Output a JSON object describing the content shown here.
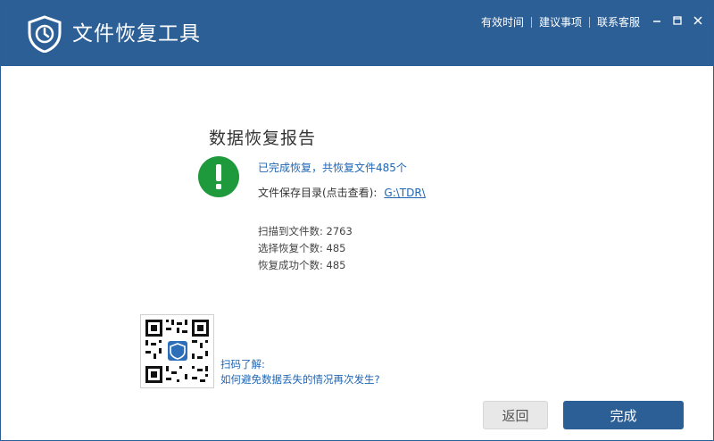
{
  "app": {
    "title": "文件恢复工具"
  },
  "header_links": [
    {
      "label": "有效时间"
    },
    {
      "label": "建议事项"
    },
    {
      "label": "联系客服"
    }
  ],
  "report": {
    "title": "数据恢复报告",
    "done_message": "已完成恢复，共恢复文件485个",
    "dir_label": "文件保存目录(点击查看):",
    "dir_path": "G:\\TDR\\",
    "stats": [
      {
        "label": "扫描到文件数:",
        "value": "2763"
      },
      {
        "label": "选择恢复个数:",
        "value": "485"
      },
      {
        "label": "恢复成功个数:",
        "value": "485"
      }
    ]
  },
  "qr": {
    "caption": "扫码了解:",
    "help_link": "如何避免数据丢失的情况再次发生?"
  },
  "buttons": {
    "back": "返回",
    "done": "完成"
  },
  "colors": {
    "brand": "#2c5f96",
    "success": "#1e9a3c",
    "link": "#1f65b3"
  },
  "icons": {
    "logo": "shield-clock-icon",
    "status": "exclamation-circle-icon",
    "minimize": "minimize-icon",
    "maximize": "maximize-icon",
    "close": "close-icon"
  }
}
